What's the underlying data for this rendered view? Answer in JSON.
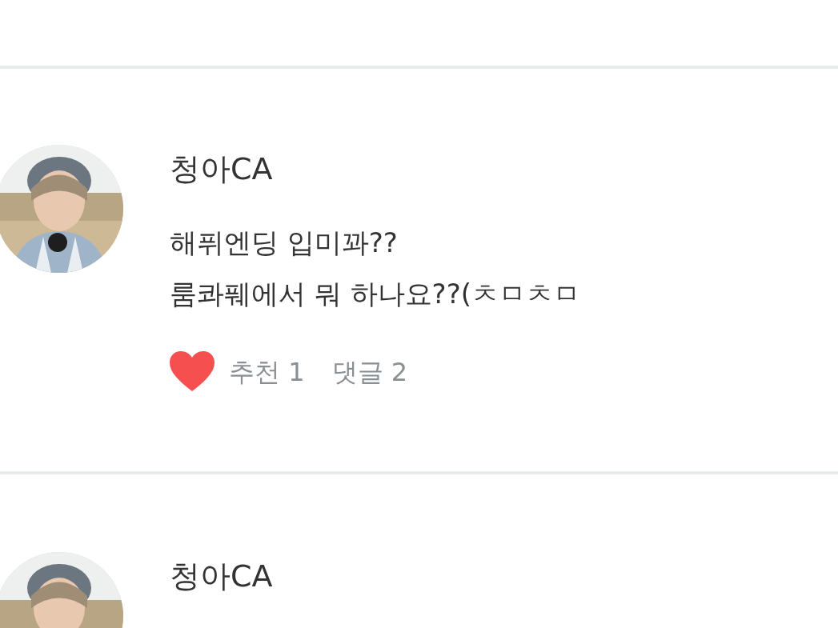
{
  "posts": [
    {
      "author": "청아CA",
      "body_lines": [
        "해퓌엔딩 입미꽈??",
        "룸콰풰에서 뭐 하나요??(ㅊㅁㅊㅁ"
      ],
      "liked": true,
      "likes": "추천 1",
      "comments": "댓글 2"
    },
    {
      "author": "청아CA"
    }
  ]
}
